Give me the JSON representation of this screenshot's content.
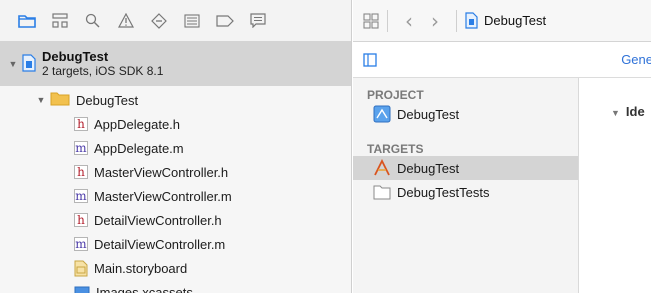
{
  "navigator": {
    "toolbar_icons": [
      "folder-icon",
      "hierarchy-icon",
      "search-icon",
      "warning-icon",
      "test-diamond-icon",
      "debug-lines-icon",
      "breakpoint-icon",
      "report-icon"
    ],
    "project": {
      "name": "DebugTest",
      "subtitle": "2 targets, iOS SDK 8.1"
    },
    "group": {
      "name": "DebugTest"
    },
    "files": [
      {
        "kind": "h",
        "name": "AppDelegate.h"
      },
      {
        "kind": "m",
        "name": "AppDelegate.m"
      },
      {
        "kind": "h",
        "name": "MasterViewController.h"
      },
      {
        "kind": "m",
        "name": "MasterViewController.m"
      },
      {
        "kind": "h",
        "name": "DetailViewController.h"
      },
      {
        "kind": "m",
        "name": "DetailViewController.m"
      },
      {
        "kind": "storyboard",
        "name": "Main.storyboard"
      },
      {
        "kind": "xcassets",
        "name": "Images.xcassets"
      }
    ]
  },
  "editor": {
    "breadcrumb": "DebugTest",
    "tab_general": "Gene",
    "project_header": "PROJECT",
    "project_item": "DebugTest",
    "targets_header": "TARGETS",
    "targets": [
      {
        "name": "DebugTest",
        "selected": true
      },
      {
        "name": "DebugTestTests",
        "selected": false
      }
    ],
    "identity_header": "Ide"
  },
  "colors": {
    "selection": "#d4d4d4",
    "accent": "#2f72d8",
    "header_h": "#b21f2d",
    "impl_m": "#4b3aa8",
    "folder": "#f2c14e"
  }
}
